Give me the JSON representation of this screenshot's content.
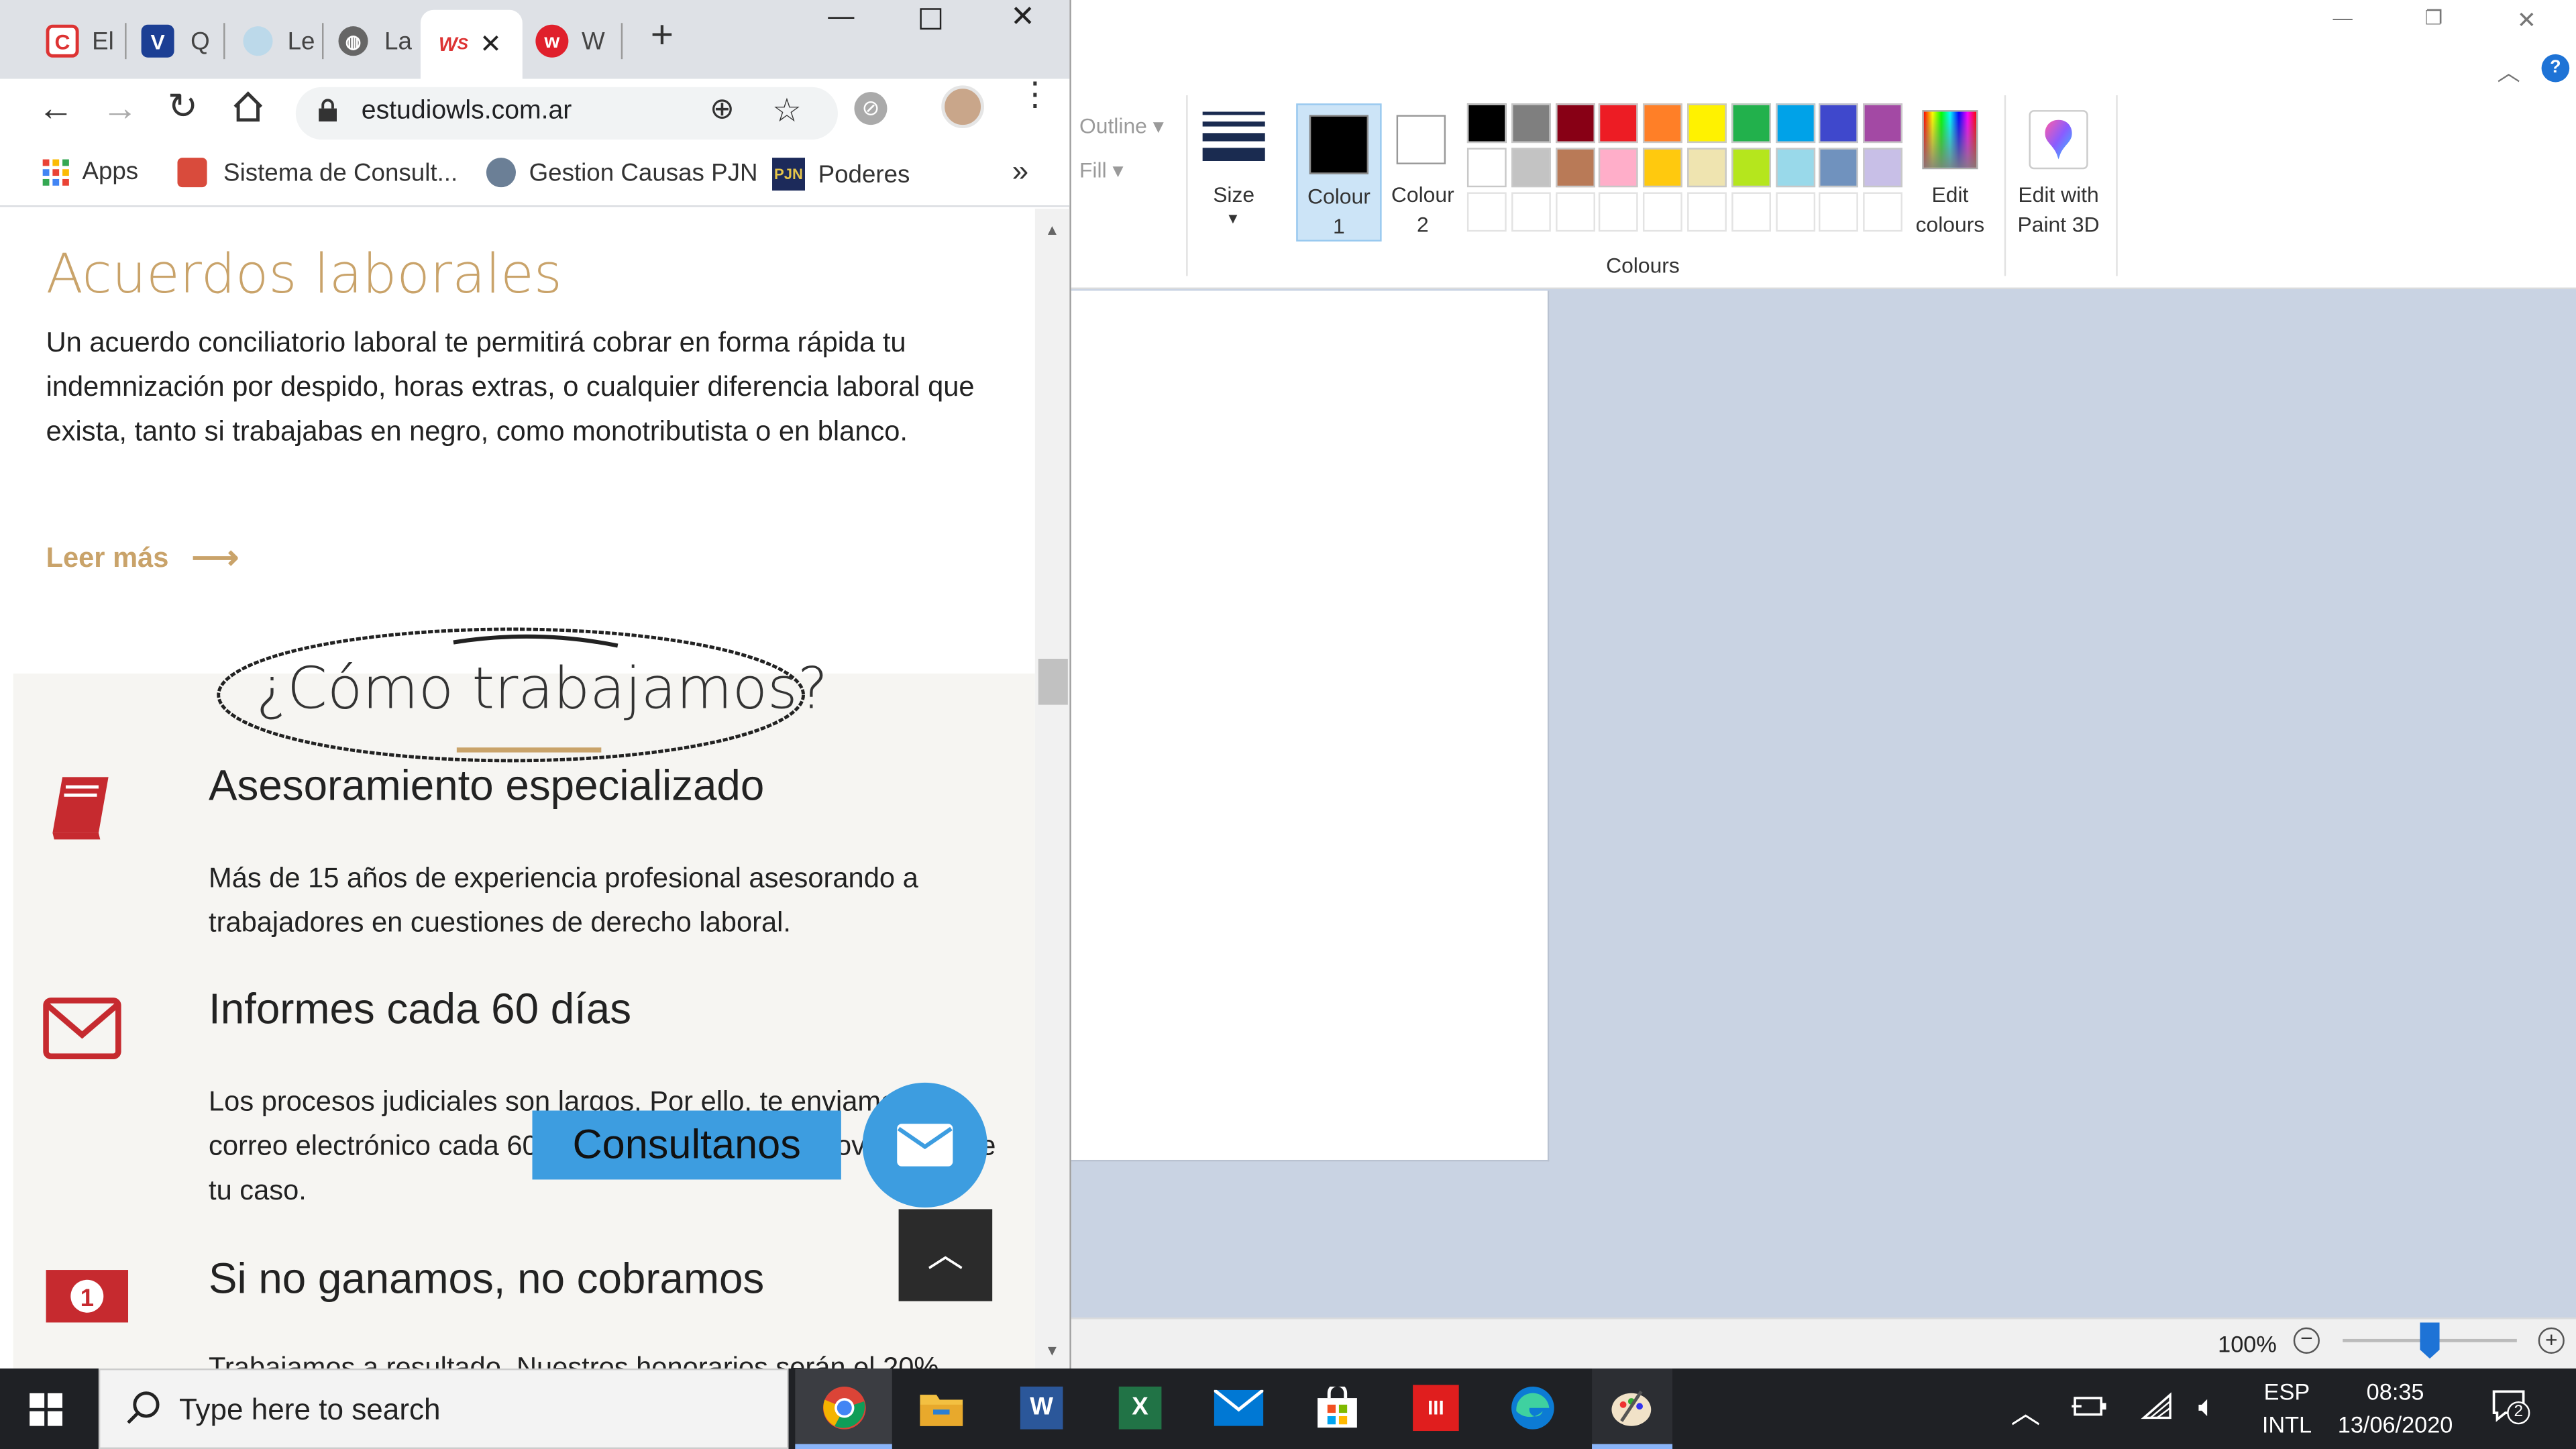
{
  "paint": {
    "outline_label": "Outline",
    "fill_label": "Fill",
    "size_label": "Size",
    "colour1_label": "Colour\n1",
    "colour2_label": "Colour\n2",
    "colours_group_label": "Colours",
    "edit_colours_label": "Edit\ncolours",
    "edit_paint3d_label": "Edit with\nPaint 3D",
    "zoom_level": "100%",
    "palette": [
      "#000000",
      "#7f7f7f",
      "#880015",
      "#ed1c24",
      "#ff7f27",
      "#fff200",
      "#22b14c",
      "#00a2e8",
      "#3f48cc",
      "#a349a4",
      "#ffffff",
      "#c3c3c3",
      "#b97a57",
      "#ffaec9",
      "#ffc90e",
      "#efe4b0",
      "#b5e61d",
      "#99d9ea",
      "#7092be",
      "#c8bfe7"
    ],
    "colour1": "#000000",
    "colour2": "#ffffff",
    "help_icon": "?"
  },
  "chrome": {
    "tabs": [
      {
        "label": "El",
        "icon": "C"
      },
      {
        "label": "Q",
        "icon": "V"
      },
      {
        "label": "Le",
        "icon": "seal"
      },
      {
        "label": "La",
        "icon": "globe"
      },
      {
        "label": "",
        "icon": "WS"
      },
      {
        "label": "W",
        "icon": "w"
      }
    ],
    "new_tab": "+",
    "url": "estudiowls.com.ar",
    "bookmarks": [
      {
        "label": "Apps"
      },
      {
        "label": "Sistema de Consult..."
      },
      {
        "label": "Gestion Causas PJN"
      },
      {
        "label": "Poderes"
      }
    ],
    "more_bookmarks": "»"
  },
  "page": {
    "section_title": "Acuerdos laborales",
    "section_text": "Un acuerdo conciliatorio laboral te permitirá cobrar en forma rápida tu indemnización por despido, horas extras, o cualquier diferencia laboral que exista, tanto si trabajabas en negro, como monotributista o en blanco.",
    "read_more": "Leer más",
    "how_title": "¿Cómo trabajamos?",
    "features": [
      {
        "title": "Asesoramiento especializado",
        "text": "Más de 15 años de experiencia profesional asesorando a trabajadores en cuestiones de derecho laboral."
      },
      {
        "title": "Informes cada 60 días",
        "text": "Los procesos judiciales son largos. Por ello, te enviamos un correo electrónico cada 60 días informándote las novedades de tu caso."
      },
      {
        "title": "Si no ganamos, no cobramos",
        "text": "Trabajamos a resultado. Nuestros honorarios serán el 20%"
      }
    ],
    "contact_button": "Consultanos",
    "accent": "#c9a36a",
    "icon_red": "#c62a2f",
    "contact_blue": "#3d9de0"
  },
  "taskbar": {
    "search_placeholder": "Type here to search",
    "lang_top": "ESP",
    "lang_bottom": "INTL",
    "time": "08:35",
    "date": "13/06/2020",
    "notification_count": "2"
  }
}
